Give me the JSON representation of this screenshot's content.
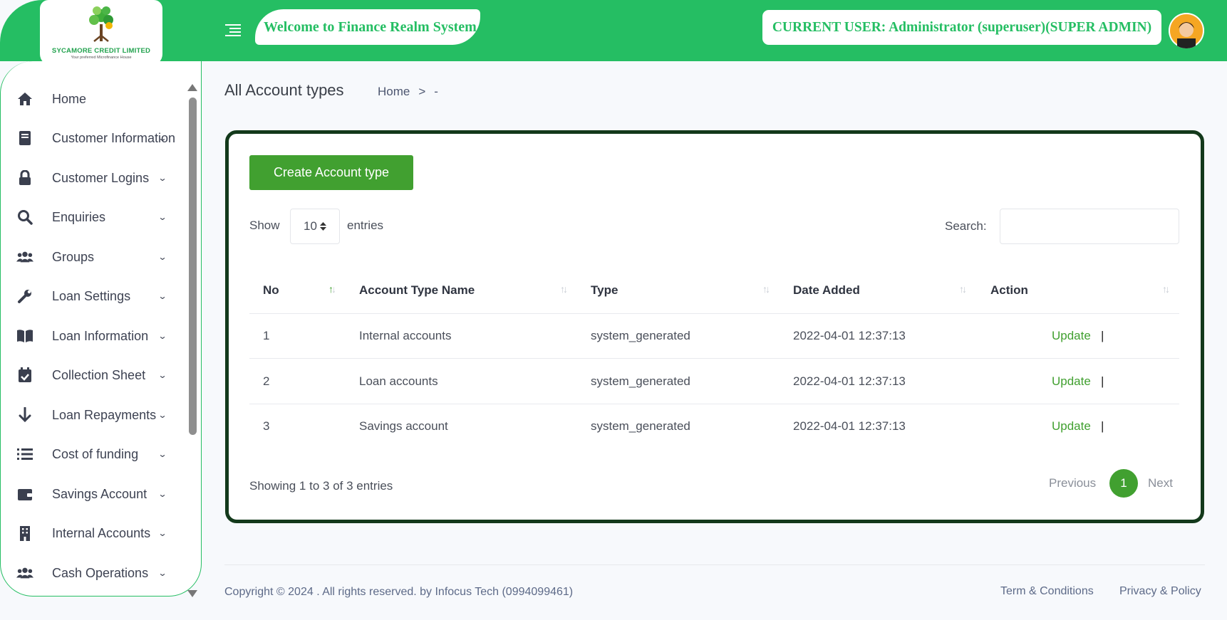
{
  "header": {
    "logo_name": "SYCAMORE CREDIT LIMITED",
    "logo_tagline": "Your preferred Microfinance House",
    "welcome_text": "Welcome to Finance Realm System",
    "current_user_text": "CURRENT USER: Administrator (superuser)(SUPER ADMIN)"
  },
  "sidebar": {
    "items": [
      {
        "label": "Home",
        "icon": "home-icon",
        "has_chevron": false
      },
      {
        "label": "Customer Information",
        "icon": "book-icon",
        "has_chevron": true
      },
      {
        "label": "Customer Logins",
        "icon": "lock-icon",
        "has_chevron": true
      },
      {
        "label": "Enquiries",
        "icon": "search-icon",
        "has_chevron": true
      },
      {
        "label": "Groups",
        "icon": "users-icon",
        "has_chevron": true
      },
      {
        "label": "Loan Settings",
        "icon": "wrench-icon",
        "has_chevron": true
      },
      {
        "label": "Loan Information",
        "icon": "open-book-icon",
        "has_chevron": true
      },
      {
        "label": "Collection Sheet",
        "icon": "calendar-check-icon",
        "has_chevron": true
      },
      {
        "label": "Loan Repayments",
        "icon": "arrow-down-icon",
        "has_chevron": true
      },
      {
        "label": "Cost of funding",
        "icon": "list-icon",
        "has_chevron": true
      },
      {
        "label": "Savings Account",
        "icon": "wallet-icon",
        "has_chevron": true
      },
      {
        "label": "Internal Accounts",
        "icon": "building-icon",
        "has_chevron": true
      },
      {
        "label": "Cash Operations",
        "icon": "users-icon",
        "has_chevron": true
      }
    ]
  },
  "page": {
    "title": "All Account types",
    "breadcrumb_home": "Home",
    "breadcrumb_sep": ">",
    "breadcrumb_current": "-"
  },
  "toolbar": {
    "create_label": "Create Account type",
    "show_label": "Show",
    "entries_value": "10",
    "entries_label": "entries",
    "search_label": "Search:",
    "search_value": ""
  },
  "table": {
    "columns": [
      "No",
      "Account Type Name",
      "Type",
      "Date Added",
      "Action"
    ],
    "rows": [
      {
        "no": "1",
        "name": "Internal accounts",
        "type": "system_generated",
        "date": "2022-04-01 12:37:13",
        "action": "Update",
        "sep": "|"
      },
      {
        "no": "2",
        "name": "Loan accounts",
        "type": "system_generated",
        "date": "2022-04-01 12:37:13",
        "action": "Update",
        "sep": "|"
      },
      {
        "no": "3",
        "name": "Savings account",
        "type": "system_generated",
        "date": "2022-04-01 12:37:13",
        "action": "Update",
        "sep": "|"
      }
    ]
  },
  "pagination": {
    "summary": "Showing 1 to 3 of 3 entries",
    "previous": "Previous",
    "current_page": "1",
    "next": "Next"
  },
  "footer": {
    "copyright": "Copyright © 2024 . All rights reserved. by Infocus Tech (0994099461)",
    "terms": "Term & Conditions",
    "privacy": "Privacy & Policy"
  },
  "colors": {
    "brand_green": "#25be63",
    "button_green": "#41a030",
    "card_border": "#13391b"
  }
}
